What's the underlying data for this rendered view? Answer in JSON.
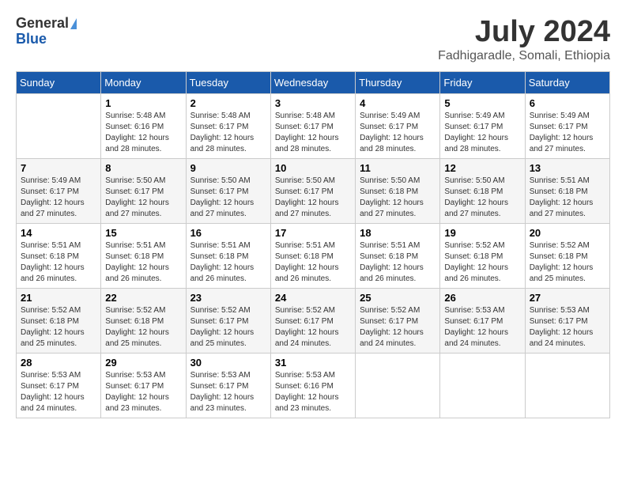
{
  "header": {
    "logo_general": "General",
    "logo_blue": "Blue",
    "month_title": "July 2024",
    "location": "Fadhigaradle, Somali, Ethiopia"
  },
  "weekdays": [
    "Sunday",
    "Monday",
    "Tuesday",
    "Wednesday",
    "Thursday",
    "Friday",
    "Saturday"
  ],
  "weeks": [
    [
      {
        "day": "",
        "detail": ""
      },
      {
        "day": "1",
        "detail": "Sunrise: 5:48 AM\nSunset: 6:16 PM\nDaylight: 12 hours\nand 28 minutes."
      },
      {
        "day": "2",
        "detail": "Sunrise: 5:48 AM\nSunset: 6:17 PM\nDaylight: 12 hours\nand 28 minutes."
      },
      {
        "day": "3",
        "detail": "Sunrise: 5:48 AM\nSunset: 6:17 PM\nDaylight: 12 hours\nand 28 minutes."
      },
      {
        "day": "4",
        "detail": "Sunrise: 5:49 AM\nSunset: 6:17 PM\nDaylight: 12 hours\nand 28 minutes."
      },
      {
        "day": "5",
        "detail": "Sunrise: 5:49 AM\nSunset: 6:17 PM\nDaylight: 12 hours\nand 28 minutes."
      },
      {
        "day": "6",
        "detail": "Sunrise: 5:49 AM\nSunset: 6:17 PM\nDaylight: 12 hours\nand 27 minutes."
      }
    ],
    [
      {
        "day": "7",
        "detail": "Sunrise: 5:49 AM\nSunset: 6:17 PM\nDaylight: 12 hours\nand 27 minutes."
      },
      {
        "day": "8",
        "detail": "Sunrise: 5:50 AM\nSunset: 6:17 PM\nDaylight: 12 hours\nand 27 minutes."
      },
      {
        "day": "9",
        "detail": "Sunrise: 5:50 AM\nSunset: 6:17 PM\nDaylight: 12 hours\nand 27 minutes."
      },
      {
        "day": "10",
        "detail": "Sunrise: 5:50 AM\nSunset: 6:17 PM\nDaylight: 12 hours\nand 27 minutes."
      },
      {
        "day": "11",
        "detail": "Sunrise: 5:50 AM\nSunset: 6:18 PM\nDaylight: 12 hours\nand 27 minutes."
      },
      {
        "day": "12",
        "detail": "Sunrise: 5:50 AM\nSunset: 6:18 PM\nDaylight: 12 hours\nand 27 minutes."
      },
      {
        "day": "13",
        "detail": "Sunrise: 5:51 AM\nSunset: 6:18 PM\nDaylight: 12 hours\nand 27 minutes."
      }
    ],
    [
      {
        "day": "14",
        "detail": "Sunrise: 5:51 AM\nSunset: 6:18 PM\nDaylight: 12 hours\nand 26 minutes."
      },
      {
        "day": "15",
        "detail": "Sunrise: 5:51 AM\nSunset: 6:18 PM\nDaylight: 12 hours\nand 26 minutes."
      },
      {
        "day": "16",
        "detail": "Sunrise: 5:51 AM\nSunset: 6:18 PM\nDaylight: 12 hours\nand 26 minutes."
      },
      {
        "day": "17",
        "detail": "Sunrise: 5:51 AM\nSunset: 6:18 PM\nDaylight: 12 hours\nand 26 minutes."
      },
      {
        "day": "18",
        "detail": "Sunrise: 5:51 AM\nSunset: 6:18 PM\nDaylight: 12 hours\nand 26 minutes."
      },
      {
        "day": "19",
        "detail": "Sunrise: 5:52 AM\nSunset: 6:18 PM\nDaylight: 12 hours\nand 26 minutes."
      },
      {
        "day": "20",
        "detail": "Sunrise: 5:52 AM\nSunset: 6:18 PM\nDaylight: 12 hours\nand 25 minutes."
      }
    ],
    [
      {
        "day": "21",
        "detail": "Sunrise: 5:52 AM\nSunset: 6:18 PM\nDaylight: 12 hours\nand 25 minutes."
      },
      {
        "day": "22",
        "detail": "Sunrise: 5:52 AM\nSunset: 6:18 PM\nDaylight: 12 hours\nand 25 minutes."
      },
      {
        "day": "23",
        "detail": "Sunrise: 5:52 AM\nSunset: 6:17 PM\nDaylight: 12 hours\nand 25 minutes."
      },
      {
        "day": "24",
        "detail": "Sunrise: 5:52 AM\nSunset: 6:17 PM\nDaylight: 12 hours\nand 24 minutes."
      },
      {
        "day": "25",
        "detail": "Sunrise: 5:52 AM\nSunset: 6:17 PM\nDaylight: 12 hours\nand 24 minutes."
      },
      {
        "day": "26",
        "detail": "Sunrise: 5:53 AM\nSunset: 6:17 PM\nDaylight: 12 hours\nand 24 minutes."
      },
      {
        "day": "27",
        "detail": "Sunrise: 5:53 AM\nSunset: 6:17 PM\nDaylight: 12 hours\nand 24 minutes."
      }
    ],
    [
      {
        "day": "28",
        "detail": "Sunrise: 5:53 AM\nSunset: 6:17 PM\nDaylight: 12 hours\nand 24 minutes."
      },
      {
        "day": "29",
        "detail": "Sunrise: 5:53 AM\nSunset: 6:17 PM\nDaylight: 12 hours\nand 23 minutes."
      },
      {
        "day": "30",
        "detail": "Sunrise: 5:53 AM\nSunset: 6:17 PM\nDaylight: 12 hours\nand 23 minutes."
      },
      {
        "day": "31",
        "detail": "Sunrise: 5:53 AM\nSunset: 6:16 PM\nDaylight: 12 hours\nand 23 minutes."
      },
      {
        "day": "",
        "detail": ""
      },
      {
        "day": "",
        "detail": ""
      },
      {
        "day": "",
        "detail": ""
      }
    ]
  ]
}
